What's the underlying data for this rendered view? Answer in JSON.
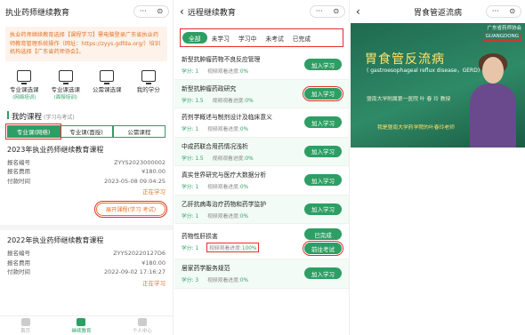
{
  "panel1": {
    "title": "执业药师继续教育",
    "capsule_more": "···",
    "capsule_close": "⊙",
    "notice": "执业药师继续教育选择【课程学习】需电脑登录广东省执业药师教育管理系统操作（网址：https://zyys.gdfda.org/）培训机构选择【广东省药师协会】。",
    "entries": [
      {
        "label": "专业课选课",
        "sub": "(网络培训)",
        "icon": "monitor-play-icon"
      },
      {
        "label": "专业课选课",
        "sub": "(面授培训)",
        "icon": "monitor-play-icon"
      },
      {
        "label": "公需课选课",
        "sub": "",
        "icon": "monitor-play-icon"
      },
      {
        "label": "我的学分",
        "sub": "",
        "icon": "monitor-list-icon"
      }
    ],
    "section_title": "我的课程",
    "section_sub": "(学习与考试)",
    "course_tabs": [
      "专业课(网络)",
      "专业课(面授)",
      "公需课程"
    ],
    "courses": [
      {
        "name": "2023年执业药师继续教育课程",
        "fields": [
          {
            "k": "报名编号",
            "v": "ZYYS2023000002"
          },
          {
            "k": "报名费用",
            "v": "¥180.00"
          },
          {
            "k": "付款时间",
            "v": "2023-05-08 09:04:25"
          }
        ],
        "status": "正在学习",
        "expand_label": "展开课程(学习 考试)"
      },
      {
        "name": "2022年执业药师继续教育课程",
        "fields": [
          {
            "k": "报名编号",
            "v": "ZYYS20220127D6"
          },
          {
            "k": "报名费用",
            "v": "¥180.00"
          },
          {
            "k": "付款时间",
            "v": "2022-09-02 17:16:27"
          }
        ],
        "status": "正在学习"
      }
    ],
    "tabbar": [
      {
        "label": "首页",
        "icon": "home-icon"
      },
      {
        "label": "继续教育",
        "icon": "education-icon"
      },
      {
        "label": "个人中心",
        "icon": "user-icon"
      }
    ]
  },
  "panel2": {
    "title": "远程继续教育",
    "back": "‹",
    "filters": [
      "全部",
      "未学习",
      "学习中",
      "未考试",
      "已完成"
    ],
    "list": [
      {
        "name": "新型抗肿瘤药物不良反应管理",
        "credits_label": "学分:",
        "credits": "1",
        "progress_label": "视频观看进度:",
        "progress": "0%",
        "button": "加入学习"
      },
      {
        "name": "新型抗肿瘤药政研究",
        "credits_label": "学分:",
        "credits": "1.5",
        "progress_label": "视频观看进度:",
        "progress": "0%",
        "button": "加入学习"
      },
      {
        "name": "药剂学概述与制剂设计及临床意义",
        "credits_label": "学分:",
        "credits": "1",
        "progress_label": "视频观看进度:",
        "progress": "0%",
        "button": "加入学习"
      },
      {
        "name": "中成药联合用药情况浅析",
        "credits_label": "学分:",
        "credits": "1.5",
        "progress_label": "视频观看进度:",
        "progress": "0%",
        "button": "加入学习"
      },
      {
        "name": "真实世界研究与医疗大数据分析",
        "credits_label": "学分:",
        "credits": "1",
        "progress_label": "视频观看进度:",
        "progress": "0%",
        "button": "加入学习"
      },
      {
        "name": "乙肝抗病毒治疗药物和药学监护",
        "credits_label": "学分:",
        "credits": "1",
        "progress_label": "视频观看进度:",
        "progress": "0%",
        "button": "加入学习"
      },
      {
        "name": "药物性肝损害",
        "credits_label": "学分:",
        "credits": "1",
        "progress_label": "视频观看进度:",
        "progress": "100%",
        "button_done": "已完成",
        "button": "前往考试"
      },
      {
        "name": "居家药学服务规范",
        "credits_label": "学分:",
        "credits": "3",
        "progress_label": "视频观看进度:",
        "progress": "0%",
        "button": "加入学习"
      }
    ]
  },
  "panel3": {
    "title": "胃食管返流病",
    "back": "‹",
    "video": {
      "logo": "广东省药师协会",
      "badge": "GUANGDONG",
      "title": "胃食管反流病",
      "subtitle": "( gastroesophageal reflux disease，GERD)",
      "speaker": "暨南大学附属第一医院 叶 春 玲 教授",
      "caption": "我是暨南大学药学院的叶春玲老师"
    }
  }
}
